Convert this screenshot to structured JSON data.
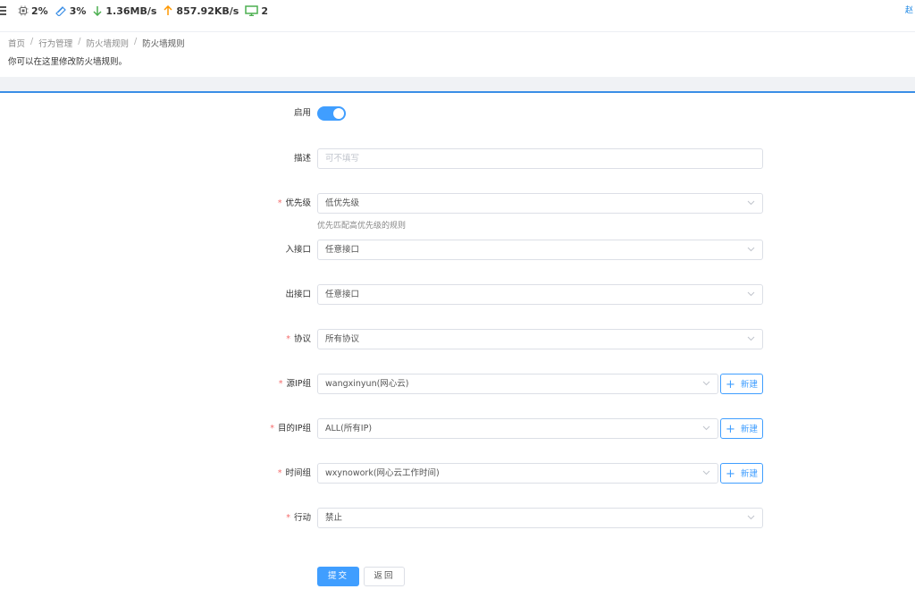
{
  "topbar": {
    "cpu": "2%",
    "memory": "3%",
    "download": "1.36MB/s",
    "upload": "857.92KB/s",
    "devices": "2",
    "corner_text": "赵"
  },
  "breadcrumb": [
    "首页",
    "行为管理",
    "防火墙规则",
    "防火墙规则"
  ],
  "page_desc": "你可以在这里修改防火墙规则。",
  "form": {
    "enable_label": "启用",
    "enable_on": true,
    "desc_label": "描述",
    "desc_placeholder": "可不填写",
    "priority_label": "优先级",
    "priority_value": "低优先级",
    "priority_hint": "优先匹配高优先级的规则",
    "in_iface_label": "入接口",
    "in_iface_value": "任意接口",
    "out_iface_label": "出接口",
    "out_iface_value": "任意接口",
    "protocol_label": "协议",
    "protocol_value": "所有协议",
    "src_ip_label": "源IP组",
    "src_ip_value": "wangxinyun(网心云)",
    "dst_ip_label": "目的IP组",
    "dst_ip_value": "ALL(所有IP)",
    "time_label": "时间组",
    "time_value": "wxynowork(网心云工作时间)",
    "action_label": "行动",
    "action_value": "禁止",
    "new_label": "新建",
    "submit_label": "提交",
    "back_label": "返回"
  },
  "colors": {
    "primary": "#409eff",
    "required": "#f56c6c",
    "download": "#4caf50",
    "upload": "#ff9800"
  }
}
